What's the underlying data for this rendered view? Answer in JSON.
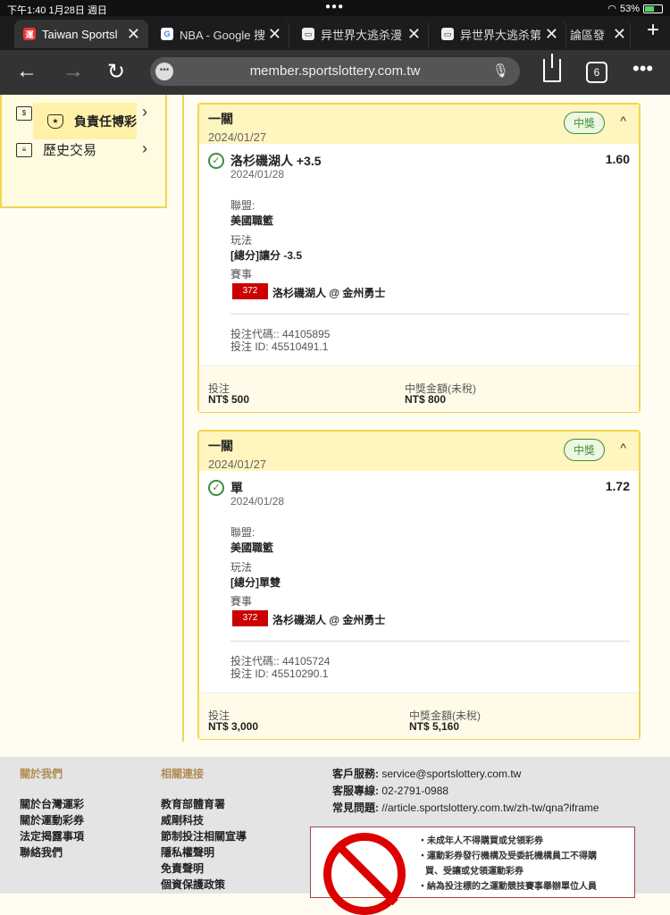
{
  "status": {
    "time": "下午1:40",
    "date": "1月28日 週日",
    "battery": "53%",
    "battery_level": 0.53
  },
  "tabs": [
    {
      "title": "Taiwan Sportsl",
      "icon": "sportslottery-icon",
      "active": true
    },
    {
      "title": "NBA - Google 搜",
      "icon": "google-icon",
      "active": false
    },
    {
      "title": "异世界大逃杀漫",
      "icon": "comic-site-icon",
      "active": false
    },
    {
      "title": "异世界大逃杀第",
      "icon": "comic-site-icon",
      "active": false
    },
    {
      "title": "論區發",
      "icon": "",
      "active": false
    }
  ],
  "tab_count": "6",
  "url": "member.sportslottery.com.tw",
  "menu": [
    {
      "label": "出金",
      "icon": "withdraw-icon",
      "selected": false
    },
    {
      "label": "歷史交易",
      "icon": "history-icon",
      "selected": false
    },
    {
      "label": "負責任博彩",
      "icon": "shield-icon",
      "selected": true
    }
  ],
  "bets": [
    {
      "type": "一關",
      "date": "2024/01/27",
      "status": "中獎",
      "selection": "洛杉磯湖人 +3.5",
      "odds": "1.60",
      "sel_date": "2024/01/28",
      "league_label": "聯盟:",
      "league": "美國職籃",
      "market_label": "玩法",
      "market": "[總分]讓分 -3.5",
      "event_label": "賽事",
      "event_no": "372",
      "event": "洛杉磯湖人 @ 金州勇士",
      "code": "投注代碼:: 44105895",
      "bet_id": "投注 ID: 45510491.1",
      "stake_label": "投注",
      "stake": "NT$ 500",
      "payout_label": "中獎金額(未稅)",
      "payout": "NT$ 800"
    },
    {
      "type": "一關",
      "date": "2024/01/27",
      "status": "中獎",
      "selection": "單",
      "odds": "1.72",
      "sel_date": "2024/01/28",
      "league_label": "聯盟:",
      "league": "美國職籃",
      "market_label": "玩法",
      "market": "[總分]單雙",
      "event_label": "賽事",
      "event_no": "372",
      "event": "洛杉磯湖人 @ 金州勇士",
      "code": "投注代碼:: 44105724",
      "bet_id": "投注 ID: 45510290.1",
      "stake_label": "投注",
      "stake": "NT$ 3,000",
      "payout_label": "中獎金額(未稅)",
      "payout": "NT$ 5,160"
    }
  ],
  "footer": {
    "about_title": "關於我們",
    "about_links": [
      "關於台灣運彩",
      "關於運動彩券",
      "法定揭露事項",
      "聯絡我們"
    ],
    "related_title": "相關連接",
    "related_links": [
      "教育部體育署",
      "威剛科技",
      "節制投注相關宣導",
      "隱私權聲明",
      "免責聲明",
      "個資保護政策"
    ],
    "service_label": "客戶服務:",
    "service": "service@sportslottery.com.tw",
    "hotline_label": "客服專線:",
    "hotline": "02-2791-0988",
    "faq_label": "常見問題:",
    "faq": "//article.sportslottery.com.tw/zh-tw/qna?iframe",
    "warnings": [
      "・未成年人不得購買或兌領彩券",
      "・運動彩券發行機構及受委託機構員工不得購",
      "買、受讓或兌領運動彩券",
      "・納為投注標的之運動競技賽事舉辦單位人員"
    ]
  }
}
